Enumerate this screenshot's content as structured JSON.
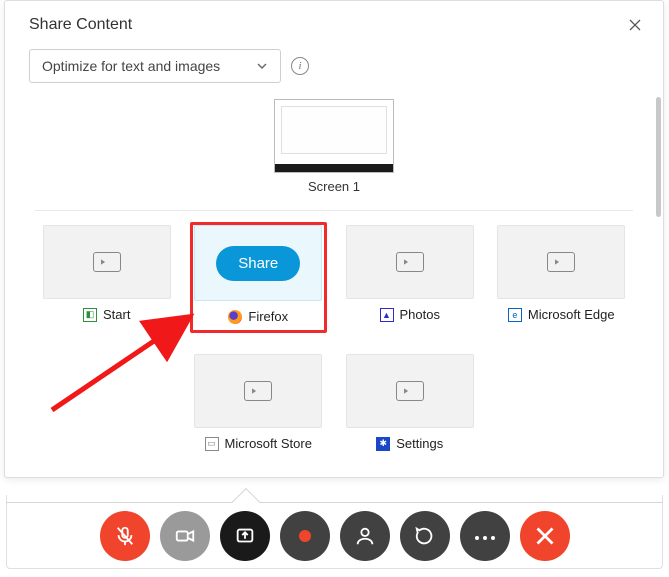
{
  "header": {
    "title": "Share Content"
  },
  "optimize": {
    "selected": "Optimize for text and images"
  },
  "screens": [
    {
      "label": "Screen 1"
    }
  ],
  "apps": [
    {
      "id": "start",
      "label": "Start"
    },
    {
      "id": "firefox",
      "label": "Firefox",
      "selected": true,
      "share_label": "Share"
    },
    {
      "id": "photos",
      "label": "Photos"
    },
    {
      "id": "edge",
      "label": "Microsoft Edge"
    },
    {
      "id": "store",
      "label": "Microsoft Store"
    },
    {
      "id": "settings",
      "label": "Settings"
    }
  ],
  "toolbar": {
    "mute": "mute-microphone",
    "video": "start-video",
    "share": "share-content",
    "record": "record",
    "participants": "participants",
    "chat": "chat",
    "more": "more-options",
    "end": "end-call"
  },
  "colors": {
    "accent_red": "#f0452c",
    "accent_blue": "#0a97d9",
    "selection_red": "#f12b2b"
  }
}
